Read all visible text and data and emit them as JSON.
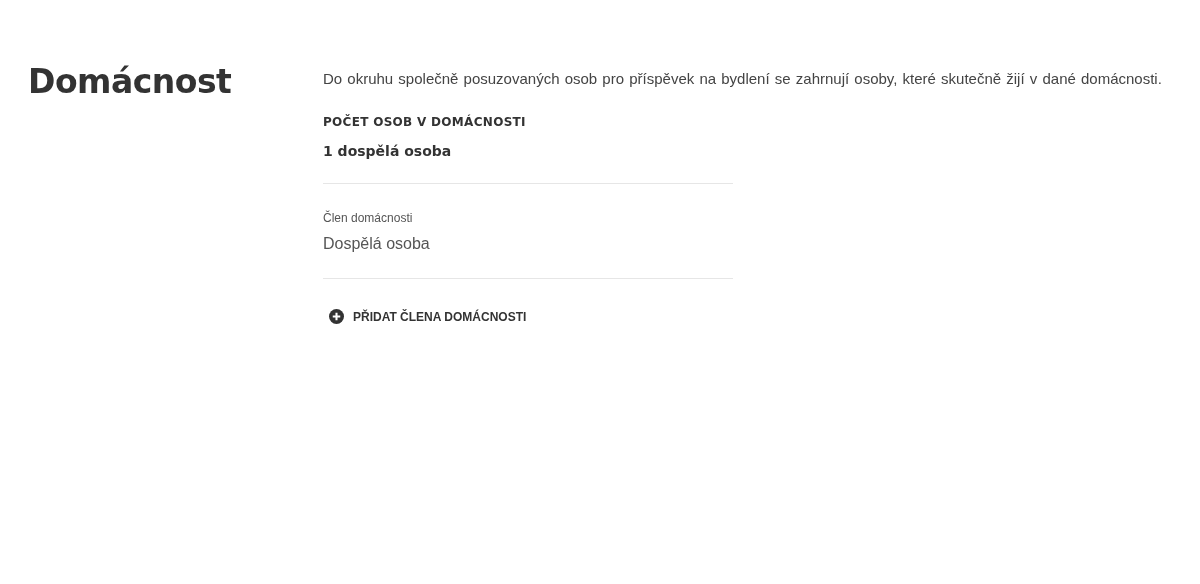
{
  "heading": "Domácnost",
  "intro": "Do okruhu společně posuzovaných osob pro příspěvek na bydlení se zahrnují osoby, které skutečně žijí v dané domácnosti.",
  "summary": {
    "label": "POČET OSOB V DOMÁCNOSTI",
    "value": "1 dospělá osoba"
  },
  "members": [
    {
      "label": "Člen domácnosti",
      "value": "Dospělá osoba"
    }
  ],
  "add_button": {
    "label": "PŘIDAT ČLENA DOMÁCNOSTI"
  }
}
